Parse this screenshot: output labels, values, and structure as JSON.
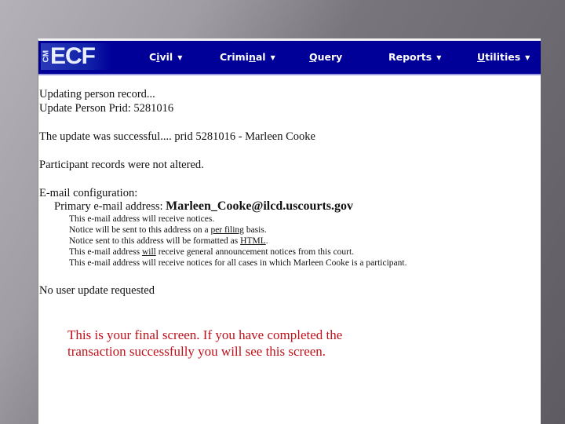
{
  "navbar": {
    "logo": {
      "prefix": "CM",
      "name": "ECF"
    },
    "menu": [
      {
        "label_pre": "C",
        "label_u": "i",
        "label_post": "vil",
        "has_dropdown": true
      },
      {
        "label_pre": "Crimi",
        "label_u": "n",
        "label_post": "al",
        "has_dropdown": true
      },
      {
        "label_pre": "",
        "label_u": "Q",
        "label_post": "uery",
        "has_dropdown": false
      },
      {
        "label_pre": "Reports",
        "label_u": "",
        "label_post": "",
        "has_dropdown": true
      },
      {
        "label_pre": "",
        "label_u": "U",
        "label_post": "tilities",
        "has_dropdown": true
      }
    ],
    "caret": "▼",
    "bg_color": "#000099"
  },
  "content": {
    "updating": "Updating person record...",
    "update_prid": "Update Person Prid: 5281016",
    "success": "The update was successful.... prid 5281016 - Marleen Cooke",
    "participant": "Participant records were not altered.",
    "email_config": "E-mail configuration:",
    "primary_label": "Primary e-mail address: ",
    "primary_email": "Marleen_Cooke@ilcd.uscourts.gov",
    "notices": {
      "l1": "This e-mail address will receive notices.",
      "l2_pre": "Notice will be sent to this address on a ",
      "l2_link": "per filing",
      "l2_post": " basis.",
      "l3_pre": "Notice sent to this address will be formatted as ",
      "l3_link": "HTML",
      "l3_post": ".",
      "l4_pre": "This e-mail address ",
      "l4_link": "will",
      "l4_post": " receive general announcement notices from this court.",
      "l5": "This e-mail address will receive notices for all cases in which Marleen Cooke is a participant."
    },
    "no_user_update": "No user update requested"
  },
  "annotation": {
    "line1": "This is your final screen.   If you have completed the",
    "line2": "transaction successfully you will see this screen.",
    "color": "#c0101a"
  }
}
